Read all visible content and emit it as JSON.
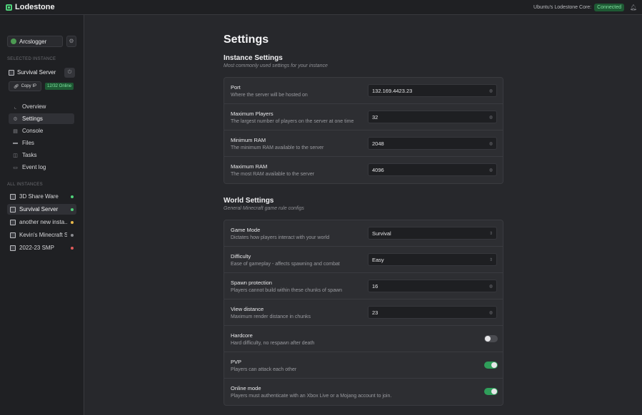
{
  "app": {
    "name": "Lodestone"
  },
  "topbar": {
    "core_label": "Ubuntu's Lodestone Core:",
    "status": "Connected"
  },
  "sidebar": {
    "user": {
      "name": "Arcslogger"
    },
    "selected_label": "SELECTED INSTANCE",
    "selected_instance": {
      "name": "Survival Server",
      "copy_ip_label": "Copy IP",
      "online": "12/32 Online"
    },
    "nav": [
      {
        "label": "Overview",
        "icon": "chart-icon"
      },
      {
        "label": "Settings",
        "icon": "sliders-icon"
      },
      {
        "label": "Console",
        "icon": "terminal-icon"
      },
      {
        "label": "Files",
        "icon": "folder-icon"
      },
      {
        "label": "Tasks",
        "icon": "tasks-icon"
      },
      {
        "label": "Event log",
        "icon": "log-icon"
      }
    ],
    "all_label": "ALL INSTANCES",
    "instances": [
      {
        "name": "3D Share Ware",
        "status_color": "#4fd27a"
      },
      {
        "name": "Survival Server",
        "status_color": "#4fd27a"
      },
      {
        "name": "another new insta...",
        "status_color": "#e8b84a"
      },
      {
        "name": "Kevin's Minecraft S...",
        "status_color": "#8a8b90"
      },
      {
        "name": "2022-23 SMP",
        "status_color": "#e05a5a"
      }
    ]
  },
  "main": {
    "title": "Settings",
    "instance_section": {
      "title": "Instance Settings",
      "subtitle": "Most commonly used settings for your instance",
      "rows": [
        {
          "label": "Port",
          "desc": "Where the server will be hosted on",
          "value": "132.169.4423.23"
        },
        {
          "label": "Maximum Players",
          "desc": "The largest number of players on the server at one time",
          "value": "32"
        },
        {
          "label": "Minimum RAM",
          "desc": "The minimum RAM available to the server",
          "value": "2048"
        },
        {
          "label": "Maximum RAM",
          "desc": "The most RAM available to the server",
          "value": "4096"
        }
      ]
    },
    "world_section": {
      "title": "World Settings",
      "subtitle": "General Minecraft game rule configs",
      "rows": [
        {
          "label": "Game Mode",
          "desc": "Dictates how players interact with your world",
          "value": "Survival"
        },
        {
          "label": "Difficulty",
          "desc": "Ease of gameplay - affects spawning and combat",
          "value": "Easy"
        },
        {
          "label": "Spawn protection",
          "desc": "Players cannot build within these chunks of spawn",
          "value": "16"
        },
        {
          "label": "View distance",
          "desc": "Maximum render distance in chunks",
          "value": "23"
        },
        {
          "label": "Hardcore",
          "desc": "Hard difficulty, no respawn after death",
          "toggle": false
        },
        {
          "label": "PVP",
          "desc": "Players can attack each other",
          "toggle": true
        },
        {
          "label": "Online mode",
          "desc": "Players must authenticate with an Xbox Live or a Mojang account to join.",
          "toggle": true
        }
      ]
    }
  }
}
